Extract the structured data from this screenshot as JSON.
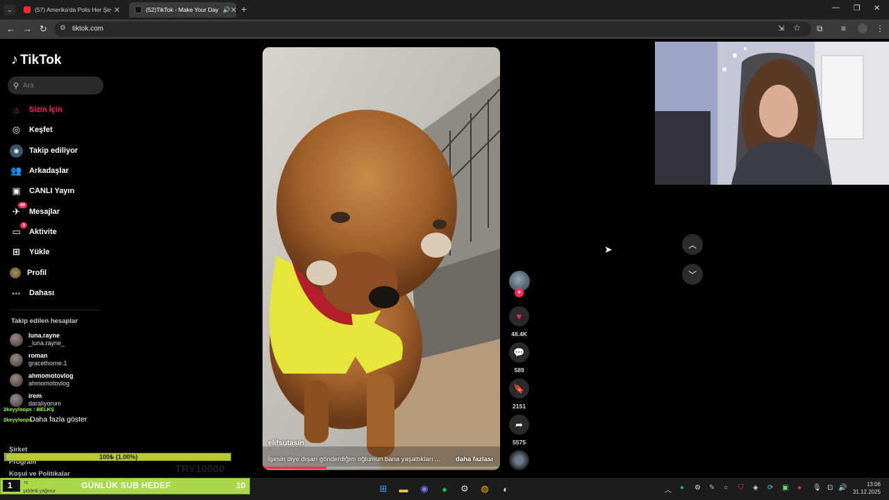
{
  "browser": {
    "tabs": [
      {
        "title": "(57) Amerika'da Polis Her Şeyi Ç",
        "close": "✕",
        "favicon_color": "#ff2a2a"
      },
      {
        "title": "(52)TikTok - Make Your Day",
        "close": "✕",
        "favicon_color": "#111111"
      }
    ],
    "new_tab": "+",
    "url": "tiktok.com"
  },
  "sidebar": {
    "logo": "TikTok",
    "search_placeholder": "Ara",
    "nav": [
      {
        "label": "Sizin İçin",
        "icon": "home-icon"
      },
      {
        "label": "Keşfet",
        "icon": "compass-icon"
      },
      {
        "label": "Takip ediliyor",
        "icon": "following-icon"
      },
      {
        "label": "Arkadaşlar",
        "icon": "friends-icon"
      },
      {
        "label": "CANLI Yayın",
        "icon": "live-icon"
      },
      {
        "label": "Mesajlar",
        "icon": "messages-icon",
        "badge": "49"
      },
      {
        "label": "Aktivite",
        "icon": "activity-icon",
        "badge": "3"
      },
      {
        "label": "Yükle",
        "icon": "upload-icon"
      },
      {
        "label": "Profil",
        "icon": "profile-icon"
      },
      {
        "label": "Dahası",
        "icon": "more-icon"
      }
    ],
    "following_title": "Takip edilen hesaplar",
    "accounts": [
      {
        "name": "luna.rayne",
        "handle": "_luna.rayne_"
      },
      {
        "name": "roman",
        "handle": "gracethorne.1"
      },
      {
        "name": "ahmomotovlog",
        "handle": "ahmomotovlog"
      },
      {
        "name": "irem",
        "handle": "daraliyorum"
      }
    ],
    "more_accounts": "Daha fazla göster",
    "footer": [
      "Şirket",
      "Program",
      "Koşul ve Politikalar"
    ]
  },
  "overlay": {
    "chat": [
      "2keyyloops : BELKŞ",
      "2keyyloops"
    ],
    "goal_progress_text": "100₺ (1.00%)",
    "goal_progress": 0.01,
    "ghost_amount": "TRY10000",
    "goal_number": "1",
    "goal_title": "GÜNLÜK SUB HEDEF",
    "goal_count": "10",
    "goal_sub": "şiddetli yağmur",
    "goal_rc": "rc"
  },
  "video": {
    "username": "elifsutasin",
    "caption": "İşesin diye dışarı gönderdiğim oğlumun bana yaşattıkları ...",
    "more": "daha fazlası",
    "progress": 0.27
  },
  "actions": {
    "likes": "48.4K",
    "comments": "589",
    "saves": "2151",
    "shares": "5575",
    "follow_plus": "+"
  },
  "taskbar": {
    "time": "13:06",
    "date": "31.12.2025"
  }
}
